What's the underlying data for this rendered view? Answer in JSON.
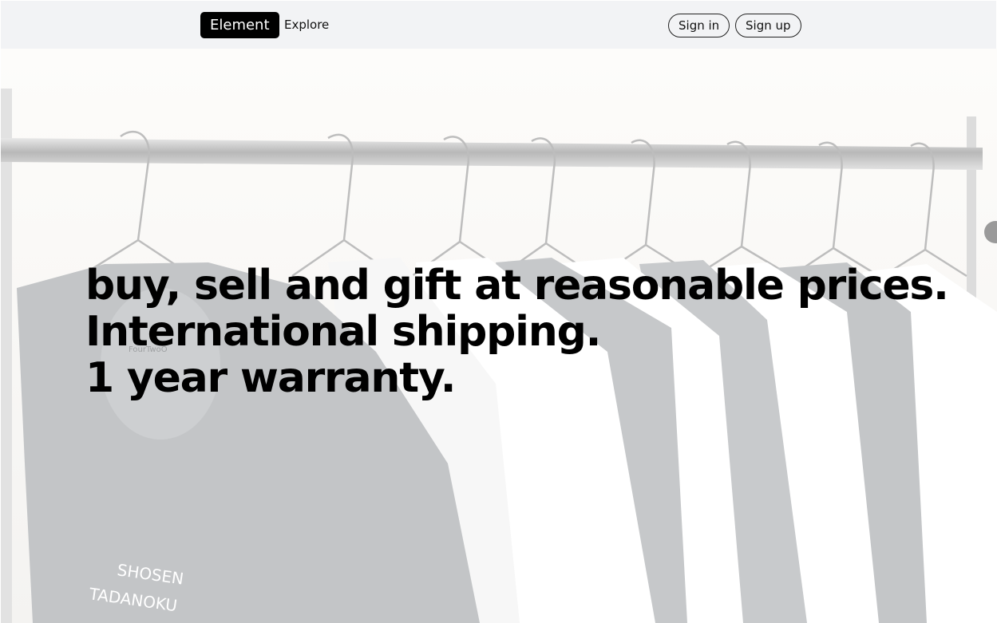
{
  "nav": {
    "brand": "Element",
    "explore": "Explore",
    "sign_in": "Sign in",
    "sign_up": "Sign up"
  },
  "hero": {
    "line1": "buy, sell and gift at reasonable prices.",
    "line2": "International shipping.",
    "line3": "1 year warranty.",
    "shirt_print_line1": "SHOSEN",
    "shirt_print_line2": "TADANOKU",
    "shirt_tag": "FourTwoO"
  },
  "colors": {
    "nav_bg": "#f2f3f5",
    "brand_bg": "#000000",
    "brand_text": "#ffffff",
    "text": "#000000",
    "rack_metal": "#c9c9c9",
    "shirt_dark": "#c3c5c7",
    "shirt_light": "#ffffff"
  }
}
